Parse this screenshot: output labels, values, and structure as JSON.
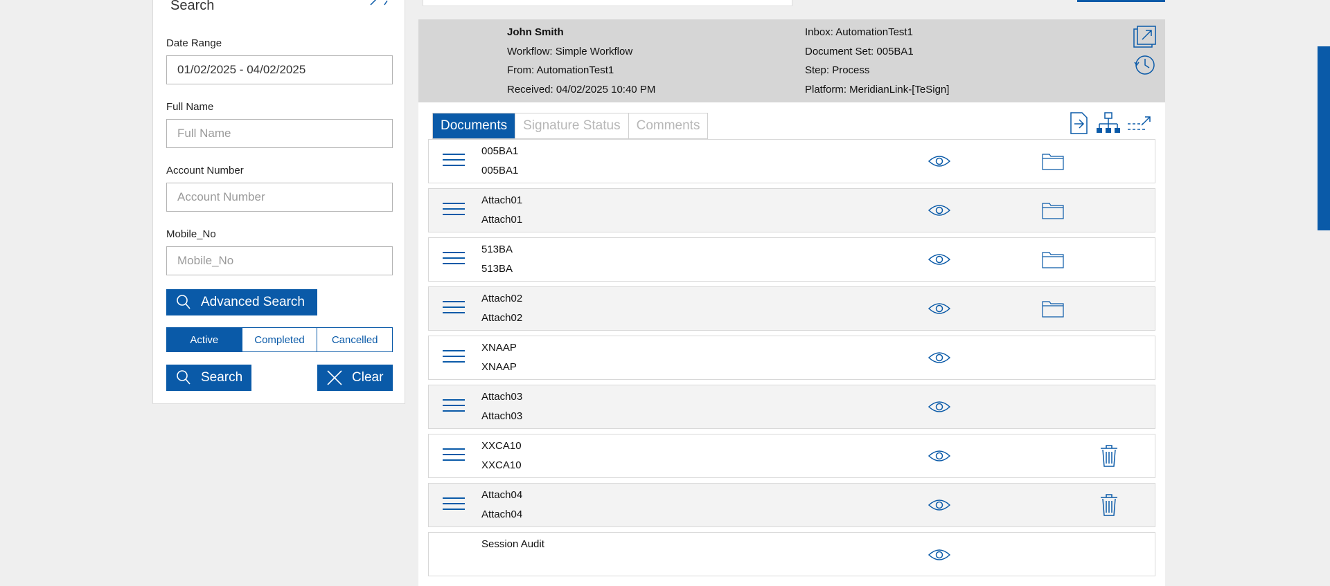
{
  "search": {
    "title": "Search",
    "date_range": {
      "label": "Date Range",
      "value": "01/02/2025 - 04/02/2025"
    },
    "full_name": {
      "label": "Full Name",
      "placeholder": "Full Name"
    },
    "account_number": {
      "label": "Account Number",
      "placeholder": "Account Number"
    },
    "mobile_no": {
      "label": "Mobile_No",
      "placeholder": "Mobile_No"
    },
    "advanced_search_label": "Advanced Search",
    "status_filters": [
      "Active",
      "Completed",
      "Cancelled"
    ],
    "active_filter": "Active",
    "search_label": "Search",
    "clear_label": "Clear"
  },
  "header": {
    "name": "John Smith",
    "workflow": "Workflow: Simple Workflow",
    "from": "From: AutomationTest1",
    "received": "Received: 04/02/2025 10:40 PM",
    "inbox": "Inbox: AutomationTest1",
    "document_set": "Document Set: 005BA1",
    "step": "Step: Process",
    "platform": "Platform: MeridianLink-[TeSign]"
  },
  "tabs": [
    "Documents",
    "Signature Status",
    "Comments"
  ],
  "active_tab": "Documents",
  "documents": [
    {
      "name": "005BA1",
      "sub": "005BA1",
      "action": "folder"
    },
    {
      "name": "Attach01",
      "sub": "Attach01",
      "action": "folder"
    },
    {
      "name": "513BA",
      "sub": "513BA",
      "action": "folder"
    },
    {
      "name": "Attach02",
      "sub": "Attach02",
      "action": "folder"
    },
    {
      "name": "XNAAP",
      "sub": "XNAAP",
      "action": "none"
    },
    {
      "name": "Attach03",
      "sub": "Attach03",
      "action": "none"
    },
    {
      "name": "XXCA10",
      "sub": "XXCA10",
      "action": "trash"
    },
    {
      "name": "Attach04",
      "sub": "Attach04",
      "action": "trash"
    },
    {
      "name": "Session Audit",
      "sub": "",
      "action": "none"
    }
  ],
  "colors": {
    "accent": "#0a5aa8",
    "header_bg": "#d6d6d6",
    "page_bg": "#efefef"
  }
}
